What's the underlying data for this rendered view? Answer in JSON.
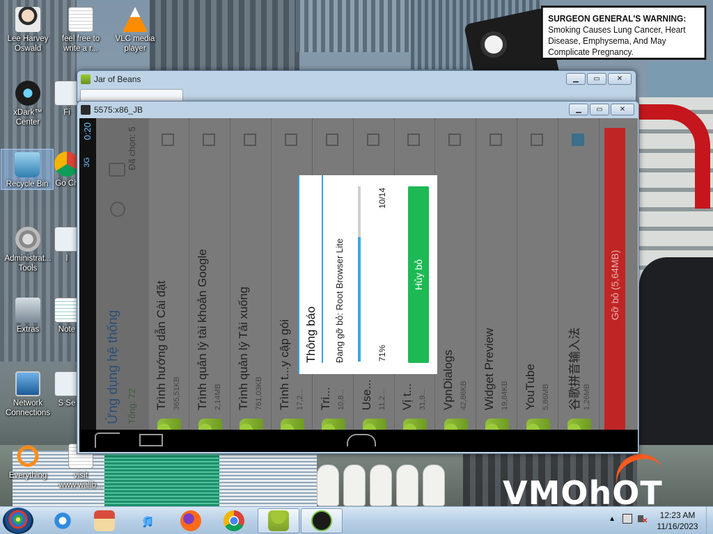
{
  "desktop": {
    "warning_bold": "SURGEON GENERAL'S WARNING:",
    "warning_text": "Smoking Causes Lung Cancer, Heart Disease, Emphysema, And May Complicate Pregnancy.",
    "wallpaper_logo": "VMOhOT",
    "icons": [
      {
        "label": "Lee Harvey Oswald"
      },
      {
        "label": "feel free to write a r..."
      },
      {
        "label": "VLC media player"
      },
      {
        "label": "xDark™ Center"
      },
      {
        "label": "Fi"
      },
      {
        "label": "Recycle Bin"
      },
      {
        "label": "Go Ch"
      },
      {
        "label": "Administrat... Tools"
      },
      {
        "label": "I"
      },
      {
        "label": "Extras"
      },
      {
        "label": "Note"
      },
      {
        "label": "Network Connections"
      },
      {
        "label": "S Se"
      },
      {
        "label": "Everything"
      },
      {
        "label": "visit www.wallb..."
      }
    ]
  },
  "windows": {
    "outer_title": "Jar of Beans",
    "inner_title": "5575:x86_JB"
  },
  "android": {
    "status_time": "0:20",
    "status_signal": "3G",
    "action_title": "Ứng dụng hệ thống",
    "action_total": "Tổng: 72",
    "action_selected": "Đã chọn: 5",
    "apps": [
      {
        "name": "Trình hướng dẫn Cài đặt",
        "size": "365,51KB",
        "checked": false
      },
      {
        "name": "Trình quản lý tài khoản Google",
        "size": "2,14MB",
        "checked": false
      },
      {
        "name": "Trình quản lý Tải xuống",
        "size": "761,03KB",
        "checked": false
      },
      {
        "name": "Trình t...y cập gói",
        "size": "17,2...",
        "checked": false
      },
      {
        "name": "Tri...",
        "size": "10,8...",
        "checked": false
      },
      {
        "name": "Use...",
        "size": "11,2...",
        "checked": false
      },
      {
        "name": "Vị t...",
        "size": "31,9...",
        "checked": false
      },
      {
        "name": "VpnDialogs",
        "size": "42,86KB",
        "checked": false
      },
      {
        "name": "Widget Preview",
        "size": "19,84KB",
        "checked": false
      },
      {
        "name": "YouTube",
        "size": "5,86MB",
        "checked": false
      },
      {
        "name": "谷歌拼音输入法",
        "size": "1,26MB",
        "checked": true
      }
    ],
    "uninstall_button": "Gỡ bỏ (5,64MB)"
  },
  "dialog": {
    "title": "Thông báo",
    "message": "Đang gỡ bỏ: Root Browser Lite",
    "progress": 0.71,
    "percent_label": "71%",
    "count_label": "10/14",
    "cancel_label": "Hủy bỏ"
  },
  "taskbar": {
    "time": "12:23 AM",
    "date": "11/16/2023",
    "apps": [
      "internet-explorer",
      "store",
      "itunes",
      "firefox",
      "chrome",
      "android-emulator",
      "android-terminal"
    ]
  }
}
